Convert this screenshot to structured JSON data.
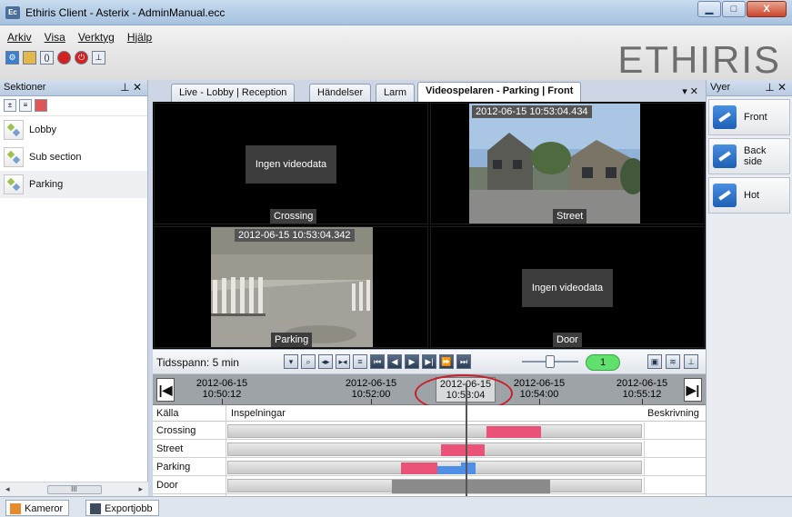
{
  "window": {
    "title": "Ethiris Client - Asterix - AdminManual.ecc",
    "icon_text": "Ec",
    "minimize": "▁",
    "maximize": "□",
    "close": "X"
  },
  "menu": [
    "Arkiv",
    "Visa",
    "Verktyg",
    "Hjälp"
  ],
  "brand": "ETHIRIS",
  "sections_panel": {
    "title": "Sektioner",
    "items": [
      {
        "label": "Lobby"
      },
      {
        "label": "Sub section"
      },
      {
        "label": "Parking"
      }
    ],
    "scroll_thumb": "III"
  },
  "views_panel": {
    "title": "Vyer",
    "items": [
      {
        "label": "Front"
      },
      {
        "label": "Back side"
      },
      {
        "label": "Hot"
      }
    ]
  },
  "tabs": [
    {
      "label": "Live - Lobby | Reception"
    },
    {
      "label": "Händelser"
    },
    {
      "label": "Larm"
    },
    {
      "label": "Videospelaren - Parking | Front"
    }
  ],
  "tab_controls": "▾  ✕",
  "video_cells": [
    {
      "camera": "Crossing",
      "no_data": "Ingen videodata"
    },
    {
      "camera": "Street",
      "timestamp": "2012-06-15 10:53:04.434"
    },
    {
      "camera": "Parking",
      "timestamp": "2012-06-15 10:53:04.342"
    },
    {
      "camera": "Door",
      "no_data": "Ingen videodata"
    }
  ],
  "controls": {
    "timespan_label": "Tidsspann: 5 min",
    "speed": "1"
  },
  "ruler": {
    "ticks": [
      {
        "date": "2012-06-15",
        "time": "10:50:12"
      },
      {
        "date": "2012-06-15",
        "time": "10:52:00"
      },
      {
        "date": "2012-06-15",
        "time": "10:54:00"
      },
      {
        "date": "2012-06-15",
        "time": "10:55:12"
      }
    ],
    "current": {
      "date": "2012-06-15",
      "time": "10:53:04"
    }
  },
  "recordings": {
    "headers": {
      "source": "Källa",
      "recordings": "Inspelningar",
      "description": "Beskrivning"
    },
    "rows": [
      {
        "source": "Crossing"
      },
      {
        "source": "Street"
      },
      {
        "source": "Parking"
      },
      {
        "source": "Door"
      }
    ]
  },
  "bottom_tabs": [
    {
      "label": "Kameror"
    },
    {
      "label": "Exportjobb"
    }
  ],
  "colors": {
    "accent": "#3c7fd0",
    "recording_event": "#ea5277",
    "recording_motion": "#4f8fe7",
    "speed_badge": "#62e06d",
    "highlight": "#c8202a"
  }
}
